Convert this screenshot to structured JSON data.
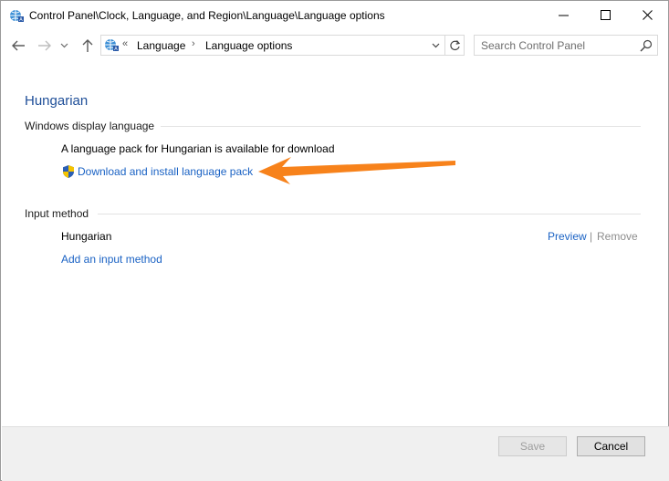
{
  "window": {
    "title": "Control Panel\\Clock, Language, and Region\\Language\\Language options",
    "minimize_glyph": "—",
    "maximize_glyph": "☐",
    "close_glyph": "✕"
  },
  "nav": {
    "breadcrumb_overflow": "«",
    "breadcrumbs": [
      {
        "label": "Language"
      },
      {
        "label": "Language options"
      }
    ],
    "breadcrumb_separator": "›",
    "search_placeholder": "Search Control Panel"
  },
  "main": {
    "heading": "Hungarian",
    "display_language": {
      "section_title": "Windows display language",
      "status_text": "A language pack for Hungarian is available for download",
      "download_link": "Download and install language pack"
    },
    "input_method": {
      "section_title": "Input method",
      "method_name": "Hungarian",
      "preview_link": "Preview",
      "separator": "|",
      "remove_link": "Remove",
      "add_link": "Add an input method"
    }
  },
  "footer": {
    "save_label": "Save",
    "cancel_label": "Cancel"
  },
  "colors": {
    "link": "#1a62c4",
    "heading": "#1e4e98",
    "annotation_arrow": "#f7821b"
  },
  "icons": [
    "control-panel-icon",
    "back-arrow-icon",
    "forward-arrow-icon",
    "chevron-down-icon",
    "up-arrow-icon",
    "refresh-icon",
    "search-icon",
    "uac-shield-icon"
  ]
}
